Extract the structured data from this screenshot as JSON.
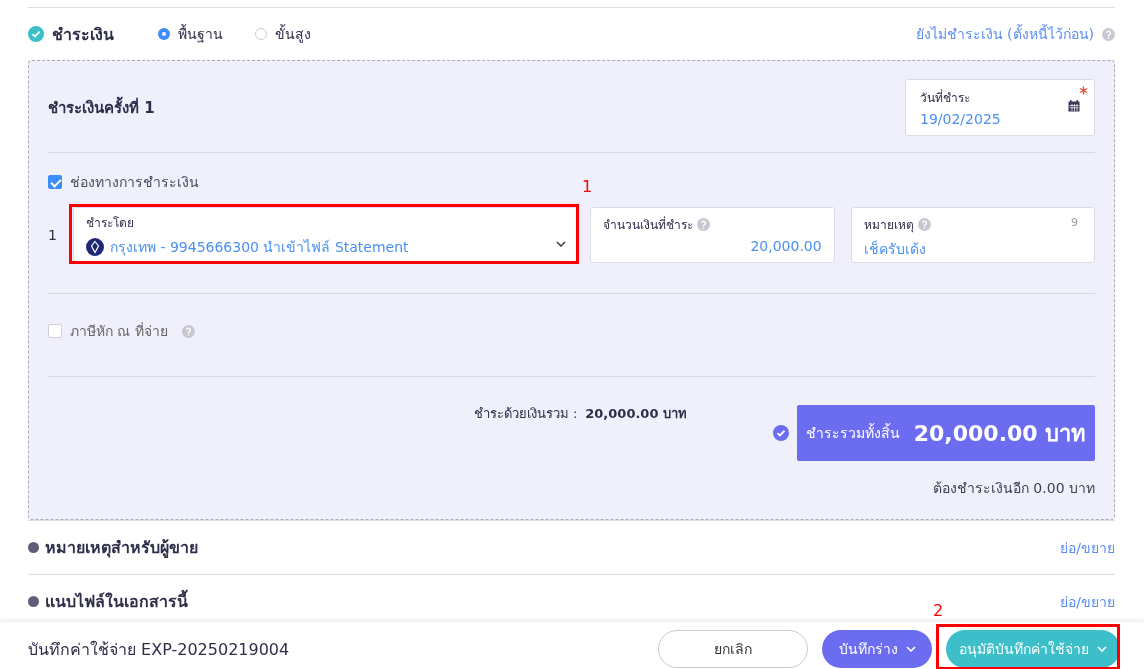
{
  "payment": {
    "title": "ชำระเงิน",
    "checked": true,
    "modes": [
      {
        "label": "พื้นฐาน",
        "selected": true
      },
      {
        "label": "ขั้นสูง",
        "selected": false
      }
    ],
    "defer_link": "ยังไม่ชำระเงิน (ตั้งหนี้ไว้ก่อน)",
    "installment": {
      "title": "ชำระเงินครั้งที่ 1",
      "date_field": {
        "label": "วันที่ชำระ",
        "value": "19/02/2025",
        "required": true
      },
      "channel": {
        "label": "ช่องทางการชำระเงิน",
        "checked": true
      },
      "row_number": "1",
      "fields": [
        {
          "kind": "select",
          "label": "ชำระโดย",
          "value": "กรุงเทพ - 9945666300 นำเข้าไฟล์ Statement",
          "annotation": "1"
        },
        {
          "kind": "number",
          "label": "จำนวนเงินที่ชำระ",
          "value": "20,000.00"
        },
        {
          "kind": "text",
          "label": "หมายเหตุ",
          "value": "เช็ครับเด้ง",
          "counter": "9"
        }
      ],
      "withholding": {
        "label": "ภาษีหัก ณ ที่จ่าย",
        "checked": false
      },
      "sum_label": "ชำระด้วยเงินรวม :",
      "sum_value": "20,000.00 บาท",
      "total": {
        "label": "ชำระรวมทั้งสิ้น",
        "value": "20,000.00 บาท",
        "confirmed": true
      },
      "remaining": "ต้องชำระเงินอีก 0.00 บาท"
    }
  },
  "sections": [
    {
      "title": "หมายเหตุสำหรับผู้ขาย",
      "toggle": "ย่อ/ขยาย"
    },
    {
      "title": "แนบไฟล์ในเอกสารนี้",
      "toggle": "ย่อ/ขยาย"
    }
  ],
  "footer": {
    "title": "บันทึกค่าใช้จ่าย EXP-20250219004",
    "buttons": [
      {
        "kind": "outline",
        "label": "ยกเลิก"
      },
      {
        "kind": "primary",
        "label": "บันทึกร่าง"
      },
      {
        "kind": "accent",
        "label": "อนุมัติบันทึกค่าใช้จ่าย",
        "annotation": "2"
      }
    ]
  }
}
